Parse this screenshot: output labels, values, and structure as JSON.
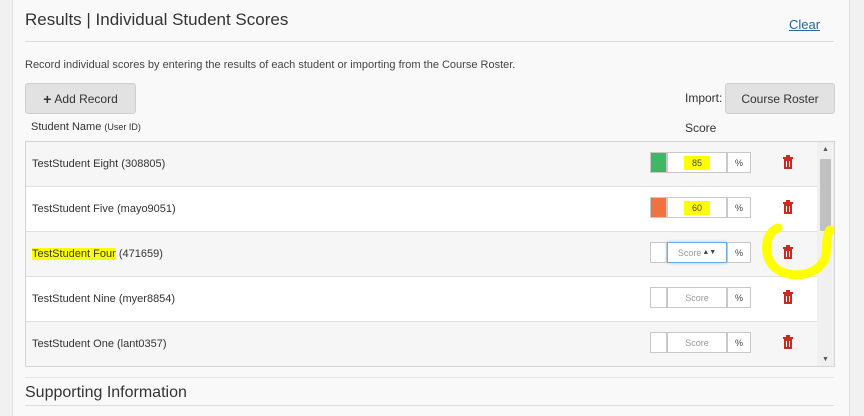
{
  "header": {
    "title": "Results | Individual Student Scores",
    "clear_label": "Clear"
  },
  "description": "Record individual scores by entering the results of each student or importing from the Course Roster.",
  "toolbar": {
    "add_record_label": "Add Record",
    "import_label": "Import:",
    "course_roster_label": "Course Roster"
  },
  "columns": {
    "student_label": "Student Name",
    "student_sub": "(User ID)",
    "score_label": "Score"
  },
  "rows": [
    {
      "name": "TestStudent Eight",
      "id": "(308805)",
      "score": "85",
      "placeholder": "Score",
      "percent": "%",
      "swatch_color": "#3fb765"
    },
    {
      "name": "TestStudent Five",
      "id": "(mayo9051)",
      "score": "60",
      "placeholder": "Score",
      "percent": "%",
      "swatch_color": "#f07241"
    },
    {
      "name": "TestStudent Four",
      "id": "(471659)",
      "score": "",
      "placeholder": "Score",
      "percent": "%",
      "swatch_color": "#ffffff"
    },
    {
      "name": "TestStudent Nine",
      "id": "(myer8854)",
      "score": "",
      "placeholder": "Score",
      "percent": "%",
      "swatch_color": "#ffffff"
    },
    {
      "name": "TestStudent One",
      "id": "(lant0357)",
      "score": "",
      "placeholder": "Score",
      "percent": "%",
      "swatch_color": "#ffffff"
    }
  ],
  "section2": {
    "title": "Supporting Information"
  },
  "colors": {
    "link": "#2a6496",
    "highlight": "#ffff00",
    "trash": "#cc2a1f"
  }
}
